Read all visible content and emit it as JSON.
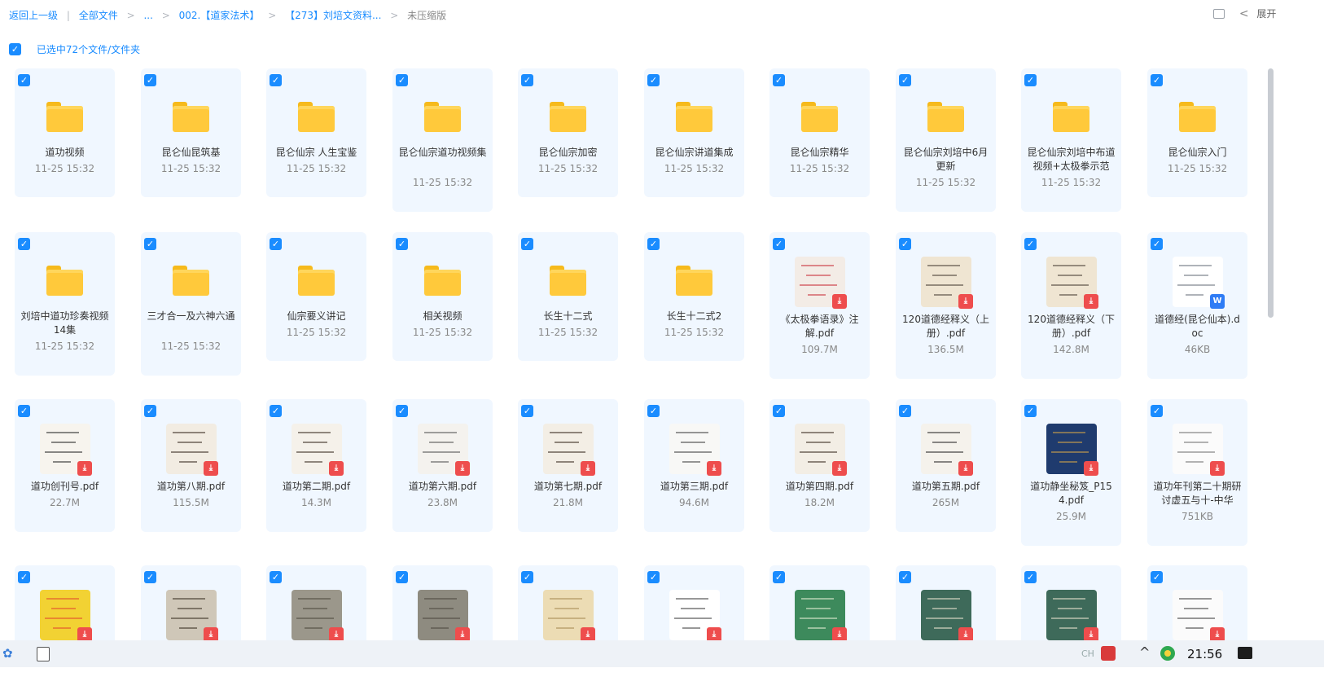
{
  "breadcrumb": {
    "back": "返回上一级",
    "sep_bar": "|",
    "sep": ">",
    "items": [
      "全部文件",
      "...",
      "002.【道家法术】",
      "【273】刘培文资料...",
      "未压缩版"
    ]
  },
  "top_right": {
    "expand_label": "展开",
    "collapse_icon": "<"
  },
  "selection": {
    "checked_mark": "✓",
    "label": "已选中72个文件/文件夹"
  },
  "files": [
    {
      "name": "道功视频",
      "meta": "11-25 15:32",
      "kind": "folder"
    },
    {
      "name": "昆仑仙昆筑基",
      "meta": "11-25 15:32",
      "kind": "folder"
    },
    {
      "name": "昆仑仙宗 人生宝鉴",
      "meta": "11-25 15:32",
      "kind": "folder"
    },
    {
      "name": "昆仑仙宗道功视频集",
      "meta": "11-25 15:32",
      "kind": "folder"
    },
    {
      "name": "昆仑仙宗加密",
      "meta": "11-25 15:32",
      "kind": "folder"
    },
    {
      "name": "昆仑仙宗讲道集成",
      "meta": "11-25 15:32",
      "kind": "folder"
    },
    {
      "name": "昆仑仙宗精华",
      "meta": "11-25 15:32",
      "kind": "folder"
    },
    {
      "name": "昆仑仙宗刘培中6月更新",
      "meta": "11-25 15:32",
      "kind": "folder"
    },
    {
      "name": "昆仑仙宗刘培中布道视频+太极拳示范",
      "meta": "11-25 15:32",
      "kind": "folder"
    },
    {
      "name": "昆仑仙宗入门",
      "meta": "11-25 15:32",
      "kind": "folder"
    },
    {
      "name": "刘培中道功珍奏视频14集",
      "meta": "11-25 15:32",
      "kind": "folder"
    },
    {
      "name": "三才合一及六神六通",
      "meta": "11-25 15:32",
      "kind": "folder"
    },
    {
      "name": "仙宗要义讲记",
      "meta": "11-25 15:32",
      "kind": "folder"
    },
    {
      "name": "相关视频",
      "meta": "11-25 15:32",
      "kind": "folder"
    },
    {
      "name": "长生十二式",
      "meta": "11-25 15:32",
      "kind": "folder"
    },
    {
      "name": "长生十二式2",
      "meta": "11-25 15:32",
      "kind": "folder"
    },
    {
      "name": "《太极拳语录》注解.pdf",
      "meta": "109.7M",
      "kind": "pdf",
      "color": "#c9323a",
      "bg": "#f3ece6"
    },
    {
      "name": "120道德经释义（上册）.pdf",
      "meta": "136.5M",
      "kind": "pdf",
      "color": "#4a4236",
      "bg": "#efe5d2"
    },
    {
      "name": "120道德经释义（下册）.pdf",
      "meta": "142.8M",
      "kind": "pdf",
      "color": "#4a4236",
      "bg": "#efe5d2"
    },
    {
      "name": "道德经(昆仑仙本).doc",
      "meta": "46KB",
      "kind": "word",
      "color": "#6d7480",
      "bg": "#ffffff"
    },
    {
      "name": "道功创刊号.pdf",
      "meta": "22.7M",
      "kind": "pdf",
      "color": "#2b2b2b",
      "bg": "#f7f4ee"
    },
    {
      "name": "道功第八期.pdf",
      "meta": "115.5M",
      "kind": "pdf",
      "color": "#3a2d22",
      "bg": "#f2ece2"
    },
    {
      "name": "道功第二期.pdf",
      "meta": "14.3M",
      "kind": "pdf",
      "color": "#3a2d22",
      "bg": "#f5f1ea"
    },
    {
      "name": "道功第六期.pdf",
      "meta": "23.8M",
      "kind": "pdf",
      "color": "#555555",
      "bg": "#f4f2ee"
    },
    {
      "name": "道功第七期.pdf",
      "meta": "21.8M",
      "kind": "pdf",
      "color": "#3a2d22",
      "bg": "#f3eee5"
    },
    {
      "name": "道功第三期.pdf",
      "meta": "94.6M",
      "kind": "pdf",
      "color": "#444444",
      "bg": "#f8f8f6"
    },
    {
      "name": "道功第四期.pdf",
      "meta": "18.2M",
      "kind": "pdf",
      "color": "#3a2d22",
      "bg": "#f3eee5"
    },
    {
      "name": "道功第五期.pdf",
      "meta": "265M",
      "kind": "pdf",
      "color": "#2b2b2b",
      "bg": "#f5f2ec"
    },
    {
      "name": "道功静坐秘笈_P154.pdf",
      "meta": "25.9M",
      "kind": "pdf",
      "color": "#d4a548",
      "bg": "#1f3b6e"
    },
    {
      "name": "道功年刊第二十期研讨虚五与十-中华",
      "meta": "751KB",
      "kind": "pdf",
      "color": "#777777",
      "bg": "#fbfbfb"
    },
    {
      "name": "",
      "meta": "",
      "kind": "pdf",
      "color": "#e24a2c",
      "bg": "#f2d233"
    },
    {
      "name": "",
      "meta": "",
      "kind": "pdf",
      "color": "#3d3225",
      "bg": "#cfc7b8"
    },
    {
      "name": "",
      "meta": "",
      "kind": "pdf",
      "color": "#4e4a3f",
      "bg": "#9b978b"
    },
    {
      "name": "",
      "meta": "",
      "kind": "pdf",
      "color": "#4e4a3f",
      "bg": "#8e8b80"
    },
    {
      "name": "",
      "meta": "",
      "kind": "pdf",
      "color": "#a98d55",
      "bg": "#ecdcb4"
    },
    {
      "name": "",
      "meta": "",
      "kind": "pdf",
      "color": "#444444",
      "bg": "#ffffff"
    },
    {
      "name": "",
      "meta": "",
      "kind": "pdf",
      "color": "#e6efd6",
      "bg": "#3d8a5c"
    },
    {
      "name": "",
      "meta": "",
      "kind": "pdf",
      "color": "#e8e2cf",
      "bg": "#3e6a5a"
    },
    {
      "name": "",
      "meta": "",
      "kind": "pdf",
      "color": "#e8e2cf",
      "bg": "#3e6a5a"
    },
    {
      "name": "",
      "meta": "",
      "kind": "pdf",
      "color": "#444444",
      "bg": "#fbfbfb"
    }
  ],
  "taskbar": {
    "lang": "CH",
    "chevron": "^",
    "time": "21:56"
  }
}
